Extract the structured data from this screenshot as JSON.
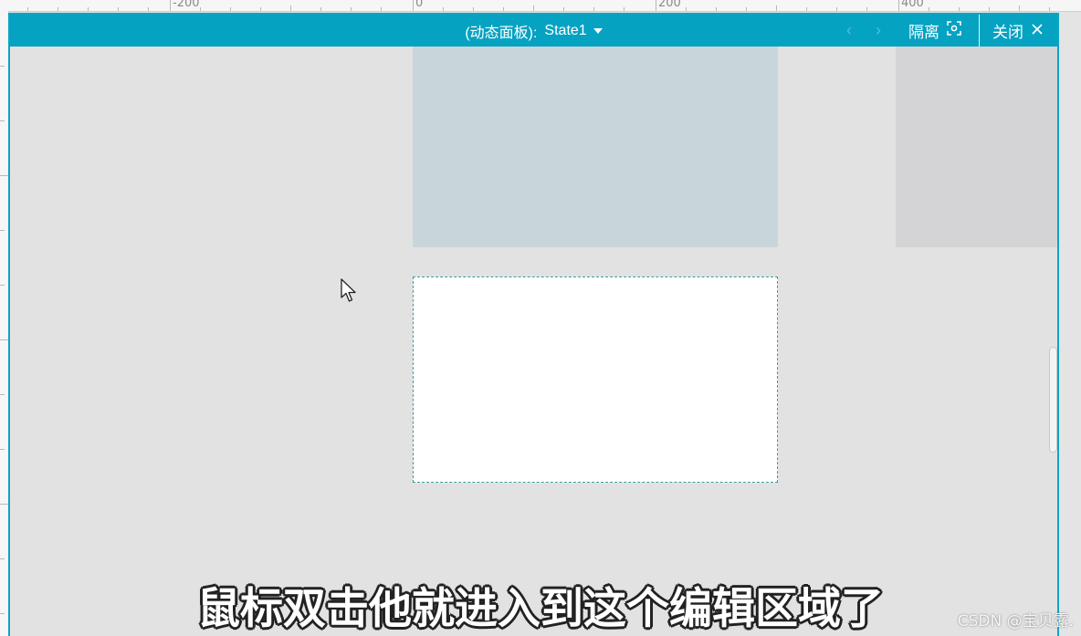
{
  "ruler": {
    "labels": [
      "-200",
      "0",
      "200",
      "400"
    ]
  },
  "titlebar": {
    "panel_label": "(动态面板):",
    "state_value": "State1",
    "prev_glyph": "‹",
    "next_glyph": "›",
    "isolate_label": "隔离",
    "close_label": "关闭"
  },
  "icons": {
    "state_caret": "caret-down-icon",
    "isolate": "target-square-icon",
    "close": "close-x-icon",
    "cursor": "mouse-pointer-icon"
  },
  "colors": {
    "accent": "#06a2c2",
    "canvas": "#e2e2e3",
    "panel_blue": "#c8d6db",
    "edit_region": "#ffffff"
  },
  "caption": {
    "text": "鼠标双击他就进入到这个编辑区域了"
  },
  "watermark": {
    "text": "CSDN @宝贝露."
  }
}
